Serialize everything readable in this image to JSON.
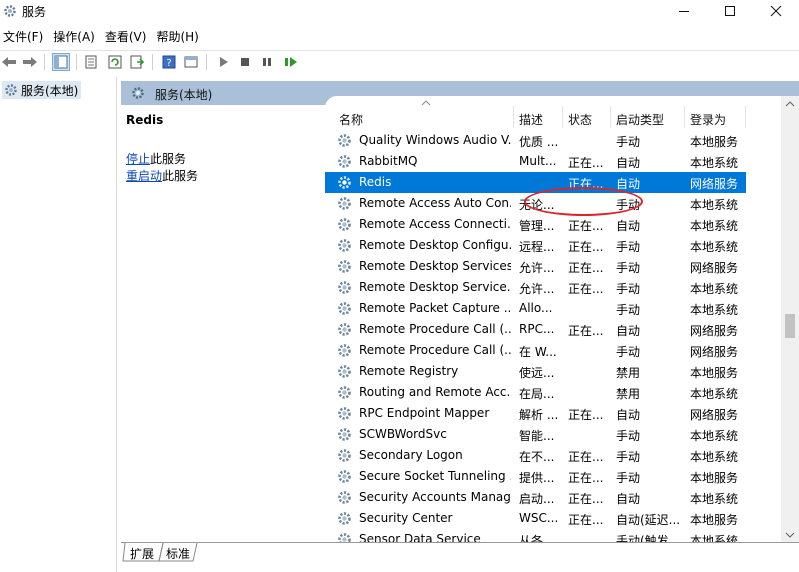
{
  "window": {
    "title": "服务",
    "minimize_label": "",
    "maximize_label": "",
    "close_label": ""
  },
  "menu": {
    "items": [
      "文件(F)",
      "操作(A)",
      "查看(V)",
      "帮助(H)"
    ]
  },
  "toolbar": {
    "icons": [
      "back-arrow-icon",
      "forward-arrow-icon",
      "show-tree-icon",
      "properties-icon",
      "refresh-icon",
      "export-list-icon",
      "help-icon",
      "console-view-icon",
      "start-service-icon",
      "stop-service-icon",
      "pause-service-icon",
      "resume-service-icon"
    ]
  },
  "tree": {
    "root_label": "服务(本地)"
  },
  "panel": {
    "header_title": "服务(本地)",
    "selected_service": "Redis",
    "actions": [
      {
        "link": "停止",
        "suffix": "此服务"
      },
      {
        "link": "重启动",
        "suffix": "此服务"
      }
    ]
  },
  "list": {
    "columns": [
      "名称",
      "描述",
      "状态",
      "启动类型",
      "登录为"
    ],
    "rows": [
      {
        "name": "Quality Windows Audio V...",
        "desc": "优质 ...",
        "status": "",
        "startup": "手动",
        "logon": "本地服务",
        "selected": false
      },
      {
        "name": "RabbitMQ",
        "desc": "Mult...",
        "status": "正在...",
        "startup": "自动",
        "logon": "本地系统",
        "selected": false
      },
      {
        "name": "Redis",
        "desc": "",
        "status": "正在...",
        "startup": "自动",
        "logon": "网络服务",
        "selected": true
      },
      {
        "name": "Remote Access Auto Con...",
        "desc": "无论...",
        "status": "",
        "startup": "手动",
        "logon": "本地系统",
        "selected": false
      },
      {
        "name": "Remote Access Connecti...",
        "desc": "管理...",
        "status": "正在...",
        "startup": "自动",
        "logon": "本地系统",
        "selected": false
      },
      {
        "name": "Remote Desktop Configu...",
        "desc": "远程...",
        "status": "正在...",
        "startup": "手动",
        "logon": "本地系统",
        "selected": false
      },
      {
        "name": "Remote Desktop Services",
        "desc": "允许...",
        "status": "正在...",
        "startup": "手动",
        "logon": "网络服务",
        "selected": false
      },
      {
        "name": "Remote Desktop Service...",
        "desc": "允许...",
        "status": "正在...",
        "startup": "手动",
        "logon": "本地系统",
        "selected": false
      },
      {
        "name": "Remote Packet Capture ...",
        "desc": "Allo...",
        "status": "",
        "startup": "手动",
        "logon": "本地系统",
        "selected": false
      },
      {
        "name": "Remote Procedure Call (...",
        "desc": "RPC...",
        "status": "正在...",
        "startup": "自动",
        "logon": "网络服务",
        "selected": false
      },
      {
        "name": "Remote Procedure Call (...",
        "desc": "在 W...",
        "status": "",
        "startup": "手动",
        "logon": "网络服务",
        "selected": false
      },
      {
        "name": "Remote Registry",
        "desc": "使远...",
        "status": "",
        "startup": "禁用",
        "logon": "本地服务",
        "selected": false
      },
      {
        "name": "Routing and Remote Acc...",
        "desc": "在局...",
        "status": "",
        "startup": "禁用",
        "logon": "本地系统",
        "selected": false
      },
      {
        "name": "RPC Endpoint Mapper",
        "desc": "解析 ...",
        "status": "正在...",
        "startup": "自动",
        "logon": "网络服务",
        "selected": false
      },
      {
        "name": "SCWBWordSvc",
        "desc": "智能...",
        "status": "",
        "startup": "手动",
        "logon": "本地系统",
        "selected": false
      },
      {
        "name": "Secondary Logon",
        "desc": "在不...",
        "status": "正在...",
        "startup": "手动",
        "logon": "本地系统",
        "selected": false
      },
      {
        "name": "Secure Socket Tunneling ...",
        "desc": "提供...",
        "status": "正在...",
        "startup": "手动",
        "logon": "本地服务",
        "selected": false
      },
      {
        "name": "Security Accounts Manag...",
        "desc": "启动...",
        "status": "正在...",
        "startup": "自动",
        "logon": "本地系统",
        "selected": false
      },
      {
        "name": "Security Center",
        "desc": "WSC...",
        "status": "正在...",
        "startup": "自动(延迟...",
        "logon": "本地服务",
        "selected": false
      },
      {
        "name": "Sensor Data Service",
        "desc": "从各...",
        "status": "",
        "startup": "手动(触发...",
        "logon": "本地系统",
        "selected": false
      }
    ]
  },
  "tabs": [
    "扩展",
    "标准"
  ],
  "colors": {
    "selection": "#0078d7",
    "panel_header": "#a9c0d8",
    "annotation": "#d9262b",
    "link": "#0b48b8"
  }
}
